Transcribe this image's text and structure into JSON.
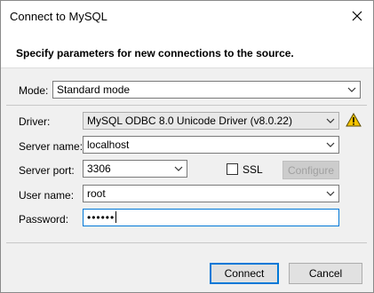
{
  "window": {
    "title": "Connect to MySQL"
  },
  "header": {
    "text": "Specify parameters for new connections to the source."
  },
  "mode": {
    "label": "Mode:",
    "value": "Standard mode"
  },
  "driver": {
    "label": "Driver:",
    "value": "MySQL ODBC 8.0 Unicode Driver (v8.0.22)"
  },
  "server_name": {
    "label": "Server name:",
    "value": "localhost"
  },
  "server_port": {
    "label": "Server port:",
    "value": "3306"
  },
  "ssl": {
    "label": "SSL",
    "checked": false
  },
  "configure": {
    "label": "Configure"
  },
  "user_name": {
    "label": "User name:",
    "value": "root"
  },
  "password": {
    "label": "Password:",
    "value": "••••••"
  },
  "buttons": {
    "connect": "Connect",
    "cancel": "Cancel"
  },
  "colors": {
    "focus": "#0078d7",
    "warning": "#f5c400",
    "background": "#f0f0f0"
  },
  "icons": [
    "close-icon",
    "chevron-down-icon",
    "warning-icon"
  ]
}
